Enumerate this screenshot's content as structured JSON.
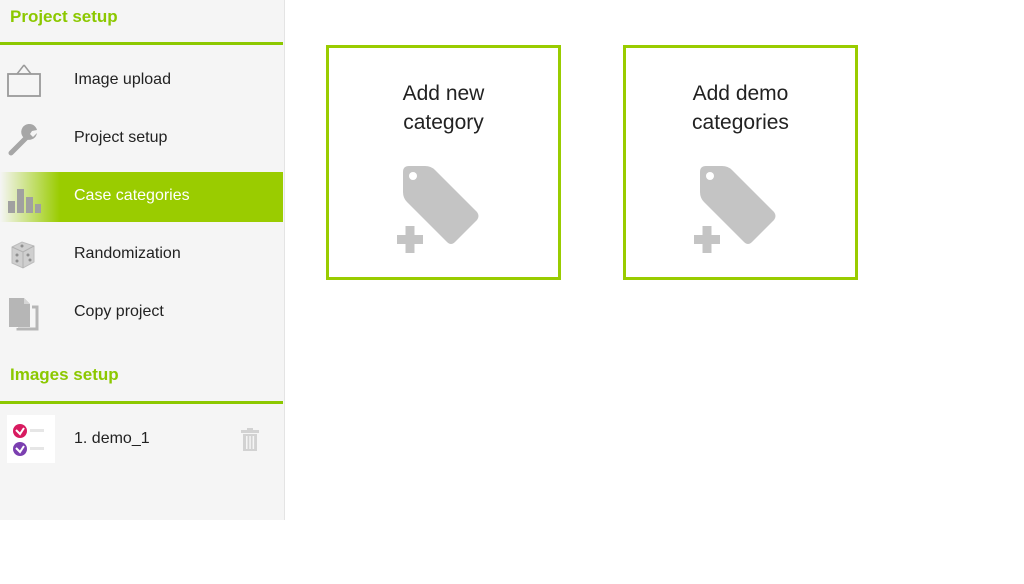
{
  "sidebar": {
    "project_section_title": "Project setup",
    "nav_items": [
      {
        "label": "Image upload",
        "icon": "picture-frame-icon",
        "active": false
      },
      {
        "label": "Project setup",
        "icon": "wrench-icon",
        "active": false
      },
      {
        "label": "Case categories",
        "icon": "bar-chart-icon",
        "active": true
      },
      {
        "label": "Randomization",
        "icon": "dice-icon",
        "active": false
      },
      {
        "label": "Copy project",
        "icon": "copy-document-icon",
        "active": false
      }
    ],
    "images_section_title": "Images setup",
    "images": [
      {
        "label": "1. demo_1",
        "thumbnail_icon": "demo-thumbnail",
        "delete_icon": "trash-icon"
      }
    ]
  },
  "main": {
    "cards": [
      {
        "label_line1": "Add new",
        "label_line2": "category",
        "icon": "tag-add-icon"
      },
      {
        "label_line1": "Add demo",
        "label_line2": "categories",
        "icon": "tag-add-icon"
      }
    ]
  },
  "colors": {
    "accent": "#99cc00",
    "section_title": "#8cc800",
    "sidebar_bg": "#f5f5f5",
    "icon_gray": "#c4c4c4"
  }
}
